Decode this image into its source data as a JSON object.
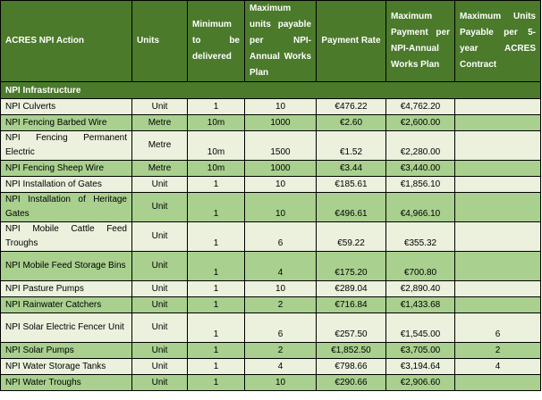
{
  "headers": {
    "action": "ACRES NPI Action",
    "units": "Units",
    "minimum": "Minimum to be delivered",
    "max_units": "Maximum units payable per NPI-Annual Works Plan",
    "rate": "Payment Rate",
    "max_payment": "Maximum Payment per NPI-Annual Works Plan",
    "max_contract": "Maximum Units Payable per 5-year ACRES Contract"
  },
  "section": "NPI Infrastructure",
  "rows": [
    {
      "action": "NPI Culverts",
      "units": "Unit",
      "min": "1",
      "max": "10",
      "rate": "€476.22",
      "payment": "€4,762.20",
      "contract": ""
    },
    {
      "action": "NPI Fencing Barbed Wire",
      "units": "Metre",
      "min": "10m",
      "max": "1000",
      "rate": "€2.60",
      "payment": "€2,600.00",
      "contract": ""
    },
    {
      "action": "NPI Fencing Permanent Electric",
      "units": "Metre",
      "min": "10m",
      "max": "1500",
      "rate": "€1.52",
      "payment": "€2,280.00",
      "contract": ""
    },
    {
      "action": "NPI Fencing Sheep Wire",
      "units": "Metre",
      "min": "10m",
      "max": "1000",
      "rate": "€3.44",
      "payment": "€3,440.00",
      "contract": ""
    },
    {
      "action": "NPI Installation of Gates",
      "units": "Unit",
      "min": "1",
      "max": "10",
      "rate": "€185.61",
      "payment": "€1,856.10",
      "contract": ""
    },
    {
      "action": "NPI Installation of Heritage Gates",
      "units": "Unit",
      "min": "1",
      "max": "10",
      "rate": "€496.61",
      "payment": "€4,966.10",
      "contract": ""
    },
    {
      "action": "NPI Mobile Cattle Feed Troughs",
      "units": "Unit",
      "min": "1",
      "max": "6",
      "rate": "€59.22",
      "payment": "€355.32",
      "contract": ""
    },
    {
      "action": "NPI Mobile Feed Storage Bins",
      "units": "Unit",
      "min": "1",
      "max": "4",
      "rate": "€175.20",
      "payment": "€700.80",
      "contract": ""
    },
    {
      "action": "NPI Pasture Pumps",
      "units": "Unit",
      "min": "1",
      "max": "10",
      "rate": "€289.04",
      "payment": "€2,890.40",
      "contract": ""
    },
    {
      "action": "NPI Rainwater Catchers",
      "units": "Unit",
      "min": "1",
      "max": "2",
      "rate": "€716.84",
      "payment": "€1,433.68",
      "contract": ""
    },
    {
      "action": "NPI Solar Electric Fencer Unit",
      "units": "Unit",
      "min": "1",
      "max": "6",
      "rate": "€257.50",
      "payment": "€1,545.00",
      "contract": "6"
    },
    {
      "action": "NPI Solar Pumps",
      "units": "Unit",
      "min": "1",
      "max": "2",
      "rate": "€1,852.50",
      "payment": "€3,705.00",
      "contract": "2"
    },
    {
      "action": "NPI Water Storage Tanks",
      "units": "Unit",
      "min": "1",
      "max": "4",
      "rate": "€798.66",
      "payment": "€3,194.64",
      "contract": "4"
    },
    {
      "action": "NPI Water Troughs",
      "units": "Unit",
      "min": "1",
      "max": "10",
      "rate": "€290.66",
      "payment": "€2,906.60",
      "contract": ""
    }
  ]
}
